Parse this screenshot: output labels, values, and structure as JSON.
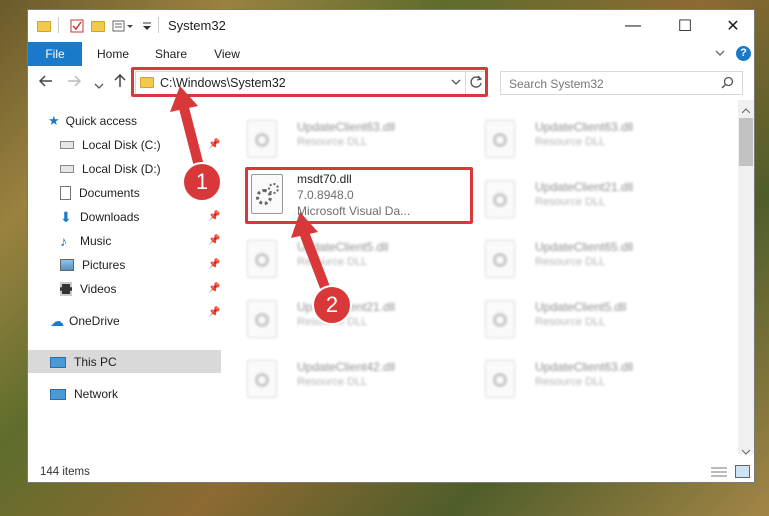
{
  "window": {
    "title": "System32",
    "controls": {
      "minimize": "—",
      "maximize": "☐",
      "close": "✕"
    }
  },
  "ribbon": {
    "tabs": [
      "File",
      "Home",
      "Share",
      "View"
    ],
    "expand_icon": "chevron-down-icon",
    "help_icon": "help-icon"
  },
  "address": {
    "path": "C:\\Windows\\System32",
    "search_placeholder": "Search System32"
  },
  "nav": {
    "items": [
      {
        "label": "Quick access",
        "icon": "star-icon",
        "pinned": false
      },
      {
        "label": "Local Disk (C:)",
        "icon": "drive-icon",
        "pinned": true
      },
      {
        "label": "Local Disk (D:)",
        "icon": "drive-icon",
        "pinned": false
      },
      {
        "label": "Documents",
        "icon": "document-icon",
        "pinned": true
      },
      {
        "label": "Downloads",
        "icon": "download-icon",
        "pinned": true
      },
      {
        "label": "Music",
        "icon": "music-icon",
        "pinned": true
      },
      {
        "label": "Pictures",
        "icon": "pictures-icon",
        "pinned": true
      },
      {
        "label": "Videos",
        "icon": "video-icon",
        "pinned": true
      },
      {
        "label": "OneDrive",
        "icon": "cloud-icon",
        "pinned": false
      },
      {
        "label": "This PC",
        "icon": "computer-icon",
        "pinned": false,
        "selected": true
      },
      {
        "label": "Network",
        "icon": "network-icon",
        "pinned": false
      }
    ]
  },
  "files": {
    "selected": {
      "name": "msdt70.dll",
      "version": "7.0.8948.0",
      "description": "Microsoft Visual Da..."
    },
    "tiles": [
      {
        "name": "UpdateClient63.dll",
        "type": "Resource DLL"
      },
      {
        "name": "UpdateClient63.dll",
        "type": "Resource DLL"
      },
      {
        "name": "UpdateClient21.dll",
        "type": "Resource DLL"
      },
      {
        "name": "UpdateClient5.dll",
        "type": "Resource DLL"
      },
      {
        "name": "UpdateClient65.dll",
        "type": "Resource DLL"
      },
      {
        "name": "UpdateClient21.dll",
        "type": "Resource DLL"
      },
      {
        "name": "UpdateClient5.dll",
        "type": "Resource DLL"
      },
      {
        "name": "UpdateClient42.dll",
        "type": "Resource DLL"
      },
      {
        "name": "UpdateClient63.dll",
        "type": "Resource DLL"
      }
    ]
  },
  "status": {
    "item_count": "144 items"
  },
  "annotations": {
    "step1": "1",
    "step2": "2",
    "color": "#d9383a"
  }
}
